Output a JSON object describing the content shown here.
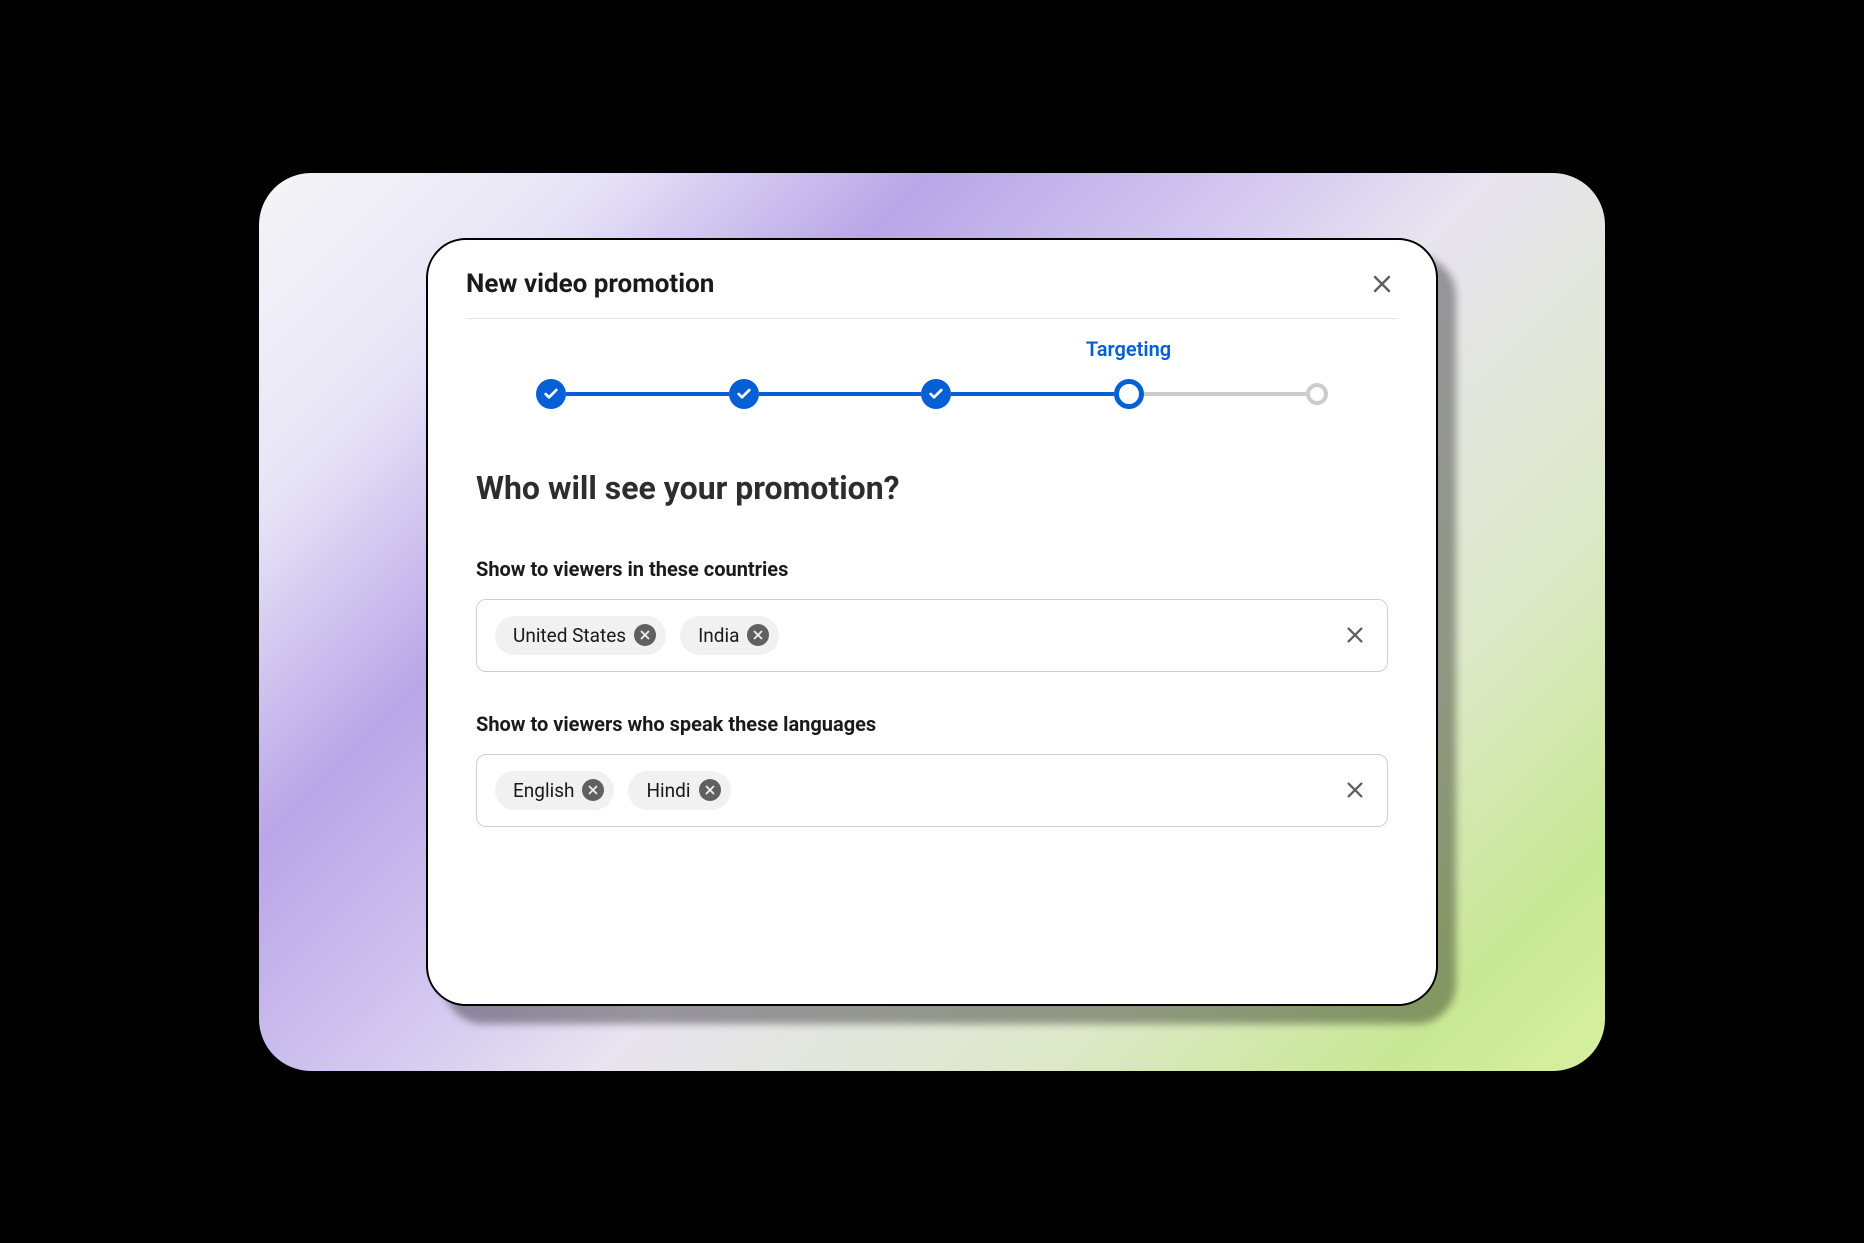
{
  "modal": {
    "title": "New video promotion"
  },
  "stepper": {
    "current_label": "Targeting"
  },
  "content": {
    "heading": "Who will see your promotion?",
    "countries": {
      "label": "Show to viewers in these countries",
      "chips": [
        "United States",
        "India"
      ]
    },
    "languages": {
      "label": "Show to viewers who speak these languages",
      "chips": [
        "English",
        "Hindi"
      ]
    }
  }
}
